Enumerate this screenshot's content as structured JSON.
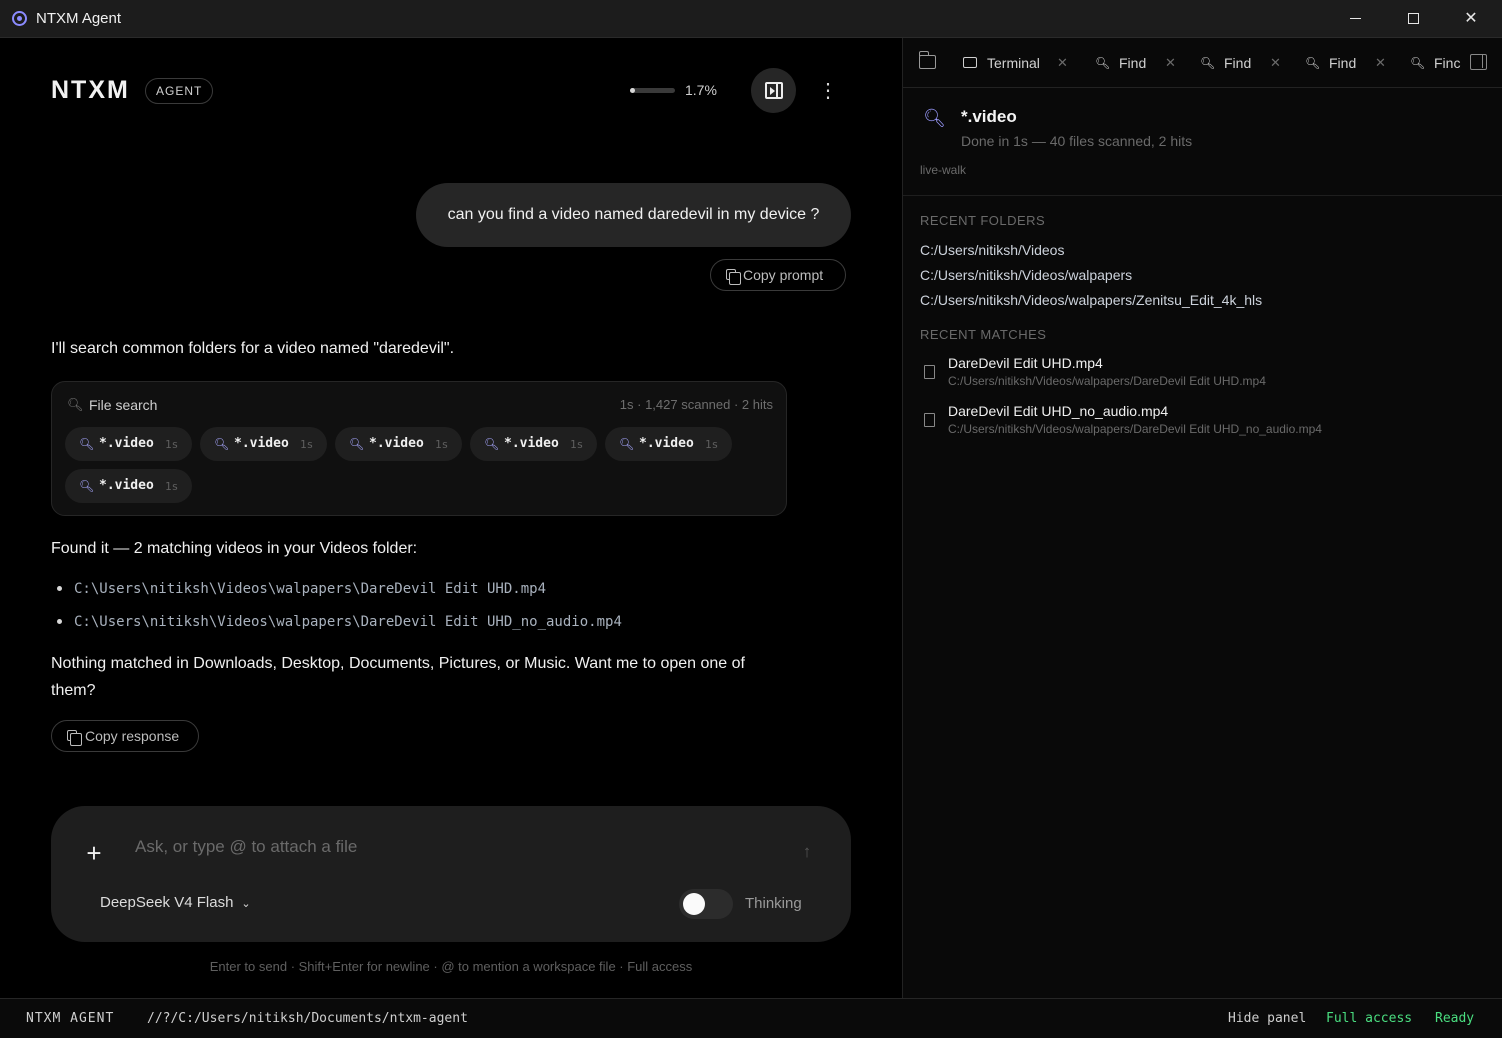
{
  "window": {
    "title": "NTXM Agent"
  },
  "header": {
    "brand": "NTXM",
    "badge": "AGENT",
    "context_usage_percent": 1.7,
    "context_usage_text": "1.7%"
  },
  "conversation": {
    "user_message": "can you find a video named daredevil in my device ?",
    "copy_prompt_label": "Copy prompt",
    "assistant_intro": "I'll search common folders for a video named \"daredevil\".",
    "tool_card": {
      "title": "File search",
      "meta": "1s · 1,427 scanned · 2 hits",
      "calls": [
        {
          "pattern": "*.video",
          "duration": "1s"
        },
        {
          "pattern": "*.video",
          "duration": "1s"
        },
        {
          "pattern": "*.video",
          "duration": "1s"
        },
        {
          "pattern": "*.video",
          "duration": "1s"
        },
        {
          "pattern": "*.video",
          "duration": "1s"
        },
        {
          "pattern": "*.video",
          "duration": "1s"
        }
      ]
    },
    "found_text": "Found it — 2 matching videos in your Videos folder:",
    "found_paths": [
      "C:\\Users\\nitiksh\\Videos\\walpapers\\DareDevil Edit UHD.mp4",
      "C:\\Users\\nitiksh\\Videos\\walpapers\\DareDevil Edit UHD_no_audio.mp4"
    ],
    "nothing_text": "Nothing matched in Downloads, Desktop, Documents, Pictures, or Music. Want me to open one of them?",
    "copy_response_label": "Copy response"
  },
  "composer": {
    "placeholder": "Ask, or type @ to attach a file",
    "value": "",
    "model": "DeepSeek V4 Flash",
    "thinking_label": "Thinking",
    "thinking_enabled": false,
    "hint": "Enter to send · Shift+Enter for newline · @ to mention a workspace file · Full access"
  },
  "panel": {
    "tabs": [
      {
        "label": "Terminal",
        "icon": "terminal-icon"
      },
      {
        "label": "Find",
        "icon": "search-icon"
      },
      {
        "label": "Find",
        "icon": "search-icon"
      },
      {
        "label": "Find",
        "icon": "search-icon"
      },
      {
        "label": "Finc",
        "icon": "search-icon"
      }
    ],
    "find": {
      "pattern": "*.video",
      "summary": "Done in 1s — 40 files scanned, 2 hits",
      "mode": "live-walk"
    },
    "recent_folders_label": "RECENT FOLDERS",
    "recent_folders": [
      "C:/Users/nitiksh/Videos",
      "C:/Users/nitiksh/Videos/walpapers",
      "C:/Users/nitiksh/Videos/walpapers/Zenitsu_Edit_4k_hls"
    ],
    "recent_matches_label": "RECENT MATCHES",
    "recent_matches": [
      {
        "name": "DareDevil Edit UHD.mp4",
        "path": "C:/Users/nitiksh/Videos/walpapers/DareDevil Edit UHD.mp4"
      },
      {
        "name": "DareDevil Edit UHD_no_audio.mp4",
        "path": "C:/Users/nitiksh/Videos/walpapers/DareDevil Edit UHD_no_audio.mp4"
      }
    ]
  },
  "statusbar": {
    "brand": "NTXM AGENT",
    "path": "//?/C:/Users/nitiksh/Documents/ntxm-agent",
    "hide_panel": "Hide panel",
    "access": "Full access",
    "state": "Ready"
  },
  "colors": {
    "accent": "#9b9bff",
    "status_green": "#4ade80"
  }
}
